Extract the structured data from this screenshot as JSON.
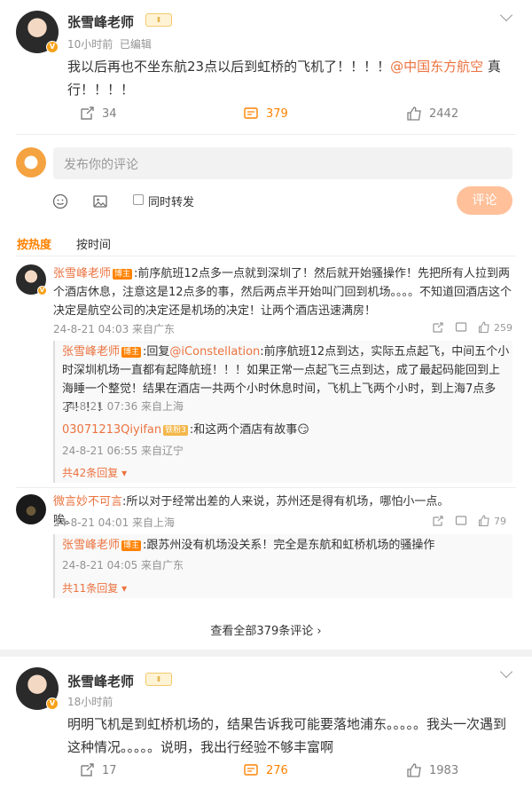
{
  "post1": {
    "author": "张雪峰老师",
    "time": "10小时前",
    "edited": "已编辑",
    "text_before": "我以后再也不坐东航23点以后到虹桥的飞机了！！！！",
    "mention": "@中国东方航空",
    "text_after": " 真行！！！！",
    "reposts": "34",
    "comments": "379",
    "likes": "2442"
  },
  "composer": {
    "placeholder": "发布你的评论",
    "repost_label": "同时转发",
    "submit_label": "评论"
  },
  "sort": {
    "hot": "按热度",
    "time": "按时间"
  },
  "comments": [
    {
      "author": "张雪峰老师",
      "tag": "博主",
      "text": ":前序航班12点多一点就到深圳了！然后就开始骚操作！先把所有人拉到两个酒店休息，注意这是12点多的事，然后两点半开始叫门回到机场。。。。不知道回酒店这个决定是航空公司的决定还是机场的决定！让两个酒店迅速满房！",
      "meta": "24-8-21 04:03 来自广东",
      "likes": "259",
      "replies": [
        {
          "author": "张雪峰老师",
          "tag": "博主",
          "prefix": ":回复",
          "mention": "@iConstellation",
          "text": ":前序航班12点到达，实际五点起飞，中间五个小时深圳机场一直都有起降航班！！！如果正常一点起飞三点到达，成了最起码能回到上海睡一个整觉！结果在酒店一共两个小时休息时间，飞机上飞两个小时，到上海7点多了！！！",
          "meta": "24-8-21 07:36 来自上海"
        },
        {
          "author": "03071213Qiyifan",
          "tag": "铁粉3",
          "text": ":和这两个酒店有故事",
          "emoji": "😏",
          "meta": "24-8-21 06:55 来自辽宁"
        }
      ],
      "more": "共42条回复"
    },
    {
      "author": "微言妙不可言",
      "text": ":所以对于经常出差的人来说，苏州还是得有机场，哪怕小一点。唉。",
      "meta": "24-8-21 04:01 来自上海",
      "likes": "79",
      "replies": [
        {
          "author": "张雪峰老师",
          "tag": "博主",
          "text": ":跟苏州没有机场没关系！完全是东航和虹桥机场的骚操作",
          "meta": "24-8-21 04:05 来自广东"
        }
      ],
      "more": "共11条回复"
    }
  ],
  "see_all": "查看全部379条评论",
  "post2": {
    "author": "张雪峰老师",
    "time": "18小时前",
    "text": "明明飞机是到虹桥机场的，结果告诉我可能要落地浦东。。。。。我头一次遇到这种情况。。。。。说明，我出行经验不够丰富啊",
    "reposts": "17",
    "comments": "276",
    "likes": "1983"
  },
  "colors": {
    "accent": "#ff8200",
    "link": "#eb7340",
    "meta": "#939393"
  }
}
